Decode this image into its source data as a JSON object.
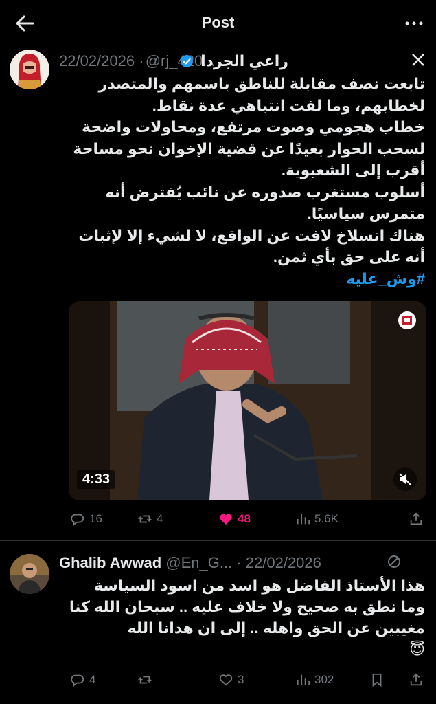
{
  "topbar": {
    "title": "Post"
  },
  "tweet1": {
    "name": "راعي الجردا",
    "handle": "@rj_420...",
    "date": "22/02/2026",
    "dot": "·",
    "text": "تابعت نصف مقابلة للناطق باسمهم والمتصدر لخطابهم، وما لفت انتباهي عدة نقاط.\nخطاب هجومي وصوت مرتفع، ومحاولات واضحة لسحب الحوار بعيدًا عن قضية الإخوان نحو مساحة أقرب إلى الشعبوية.\nأسلوب مستغرب صدوره عن نائب يُفترض أنه متمرس سياسيًا.\nهناك انسلاخ لافت عن الواقع، لا لشيء إلا لإثبات أنه على حق بأي ثمن.",
    "hashtag": "#وش_عليه",
    "video_duration": "4:33",
    "replies": "16",
    "reposts": "4",
    "likes": "48",
    "views": "5.6K"
  },
  "tweet2": {
    "name": "Ghalib Awwad",
    "handle": "@En_G...",
    "date": "22/02/2026",
    "dot": "·",
    "text": "هذا الأستاذ الفاضل هو اسد من اسود السياسة وما نطق به صحيح ولا خلاف عليه .. سبحان الله كنا مغيبين عن الحق واهله .. إلى ان هدانا الله",
    "emoji": "😇",
    "replies": "4",
    "reposts": "",
    "likes": "3",
    "views": "302"
  },
  "colors": {
    "accent": "#1d9bf0",
    "like": "#f91880",
    "muted": "#71767b",
    "bg": "#000000"
  }
}
